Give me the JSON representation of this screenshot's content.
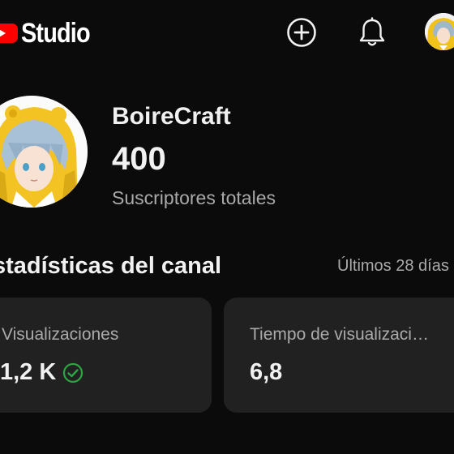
{
  "header": {
    "brand": "Studio",
    "icons": [
      "youtube-logo-icon",
      "create-plus-icon",
      "bell-icon",
      "account-avatar"
    ],
    "brand_color": "#ff0000"
  },
  "channel": {
    "name": "BoireCraft",
    "subscribers": "400",
    "subscribers_label": "Suscriptores totales"
  },
  "stats": {
    "title": "stadísticas del canal",
    "period": "Últimos 28 días",
    "cards": [
      {
        "label": "Visualizaciones",
        "value": "1,2 K",
        "status_icon": "check-circle-icon",
        "status_color": "#2ba640"
      },
      {
        "label": "Tiempo de visualizaci…",
        "value": "6,8"
      }
    ]
  }
}
